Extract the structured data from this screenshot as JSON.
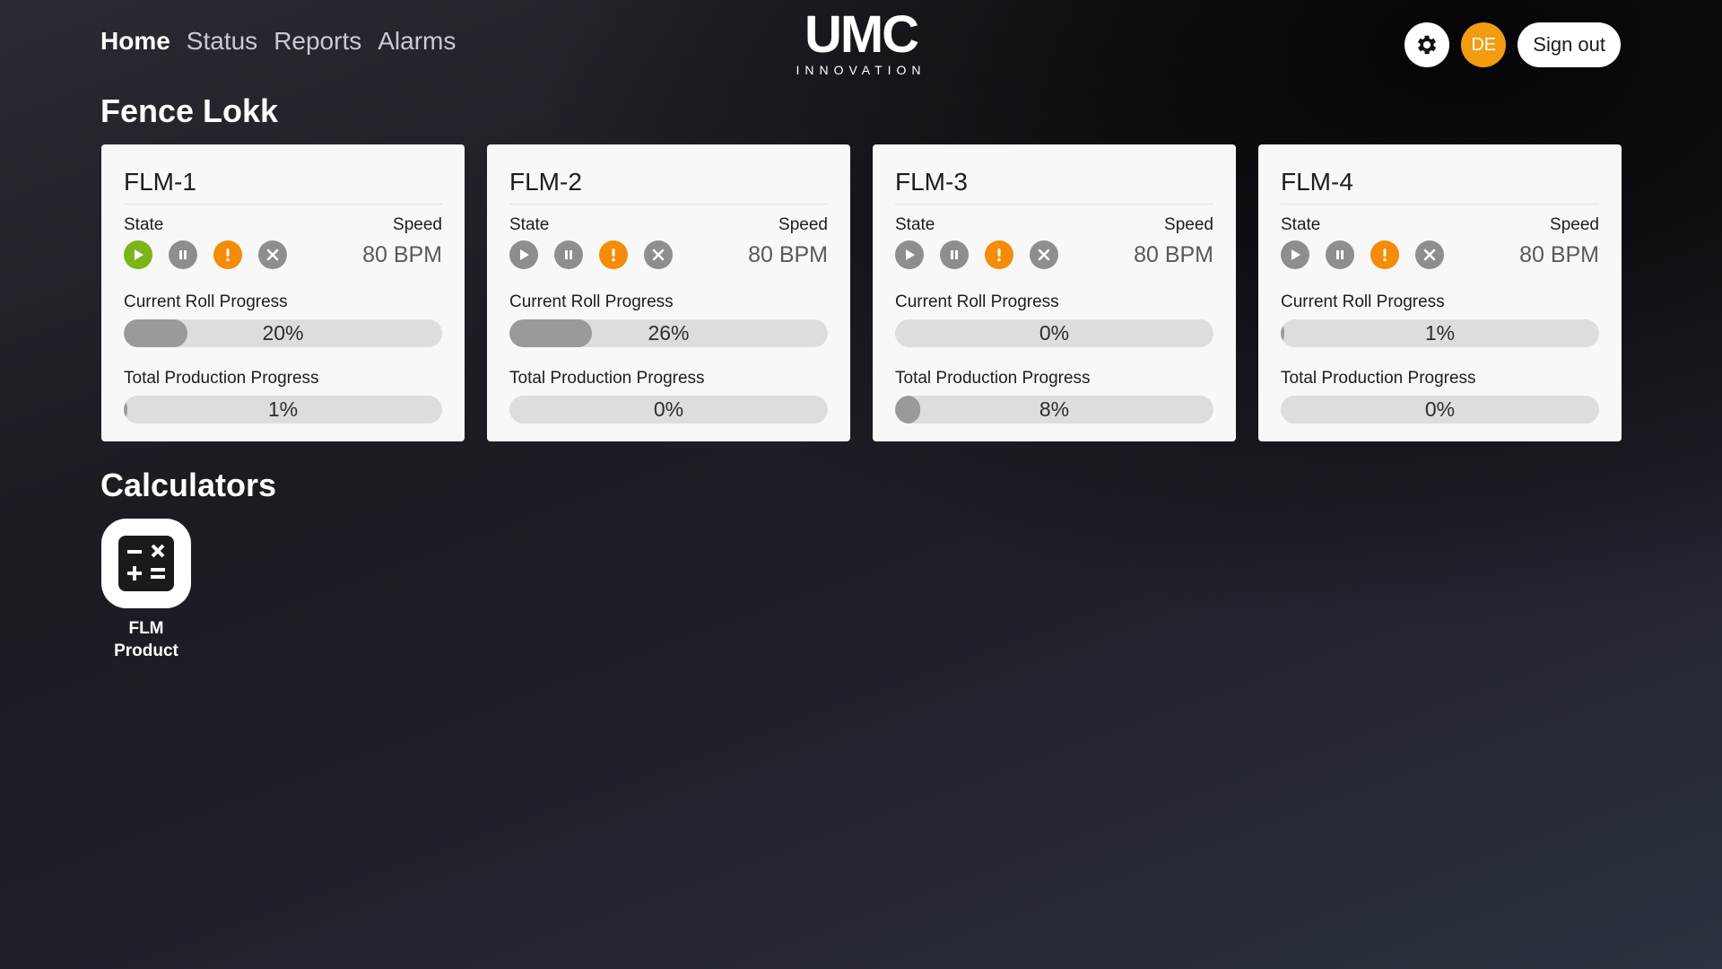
{
  "nav": [
    {
      "label": "Home",
      "active": true
    },
    {
      "label": "Status",
      "active": false
    },
    {
      "label": "Reports",
      "active": false
    },
    {
      "label": "Alarms",
      "active": false
    }
  ],
  "logo": {
    "mark": "UMC",
    "sub": "INNOVATION"
  },
  "header": {
    "settings_icon": "gear-icon",
    "avatar_initials": "DE",
    "signout_label": "Sign out",
    "avatar_color": "#f39c12"
  },
  "section_machines": "Fence Lokk",
  "labels": {
    "state": "State",
    "speed": "Speed",
    "current_roll": "Current Roll Progress",
    "total_production": "Total Production Progress"
  },
  "colors": {
    "running": "#7cb518",
    "alarm": "#f48c06",
    "inactive": "#8e8e8e"
  },
  "machines": [
    {
      "name": "FLM-1",
      "speed": "80 BPM",
      "state": "running",
      "alarm": true,
      "roll_progress": 20,
      "roll_progress_label": "20%",
      "total_progress": 1,
      "total_progress_label": "1%"
    },
    {
      "name": "FLM-2",
      "speed": "80 BPM",
      "state": "idle",
      "alarm": true,
      "roll_progress": 26,
      "roll_progress_label": "26%",
      "total_progress": 0,
      "total_progress_label": "0%"
    },
    {
      "name": "FLM-3",
      "speed": "80 BPM",
      "state": "idle",
      "alarm": true,
      "roll_progress": 0,
      "roll_progress_label": "0%",
      "total_progress": 8,
      "total_progress_label": "8%"
    },
    {
      "name": "FLM-4",
      "speed": "80 BPM",
      "state": "idle",
      "alarm": true,
      "roll_progress": 1,
      "roll_progress_label": "1%",
      "total_progress": 0,
      "total_progress_label": "0%"
    }
  ],
  "section_calculators": "Calculators",
  "calculators": [
    {
      "label_line1": "FLM",
      "label_line2": "Product",
      "icon": "calculator-icon"
    }
  ]
}
